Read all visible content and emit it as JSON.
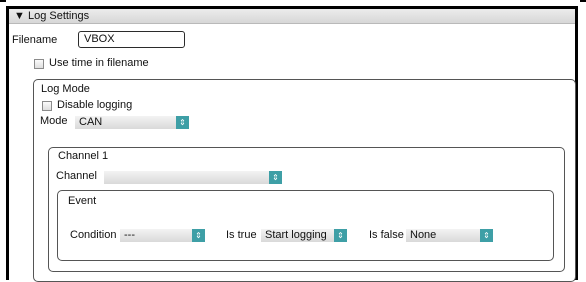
{
  "log_settings": {
    "header": "Log Settings",
    "header_toggle_icon": "triangle-down-icon",
    "filename_label": "Filename",
    "filename_value": "VBOX",
    "use_time_label": "Use time in filename"
  },
  "log_mode": {
    "title": "Log Mode",
    "disable_logging_label": "Disable logging",
    "mode_label": "Mode",
    "mode_value": "CAN"
  },
  "channel": {
    "title": "Channel 1",
    "channel_label": "Channel",
    "channel_value": ""
  },
  "event": {
    "title": "Event",
    "condition_label": "Condition",
    "condition_value": "---",
    "is_true_label": "Is true",
    "is_true_value": "Start logging",
    "is_false_label": "Is false",
    "is_false_value": "None"
  },
  "select_arrow_icon": "up-down-arrows-icon"
}
